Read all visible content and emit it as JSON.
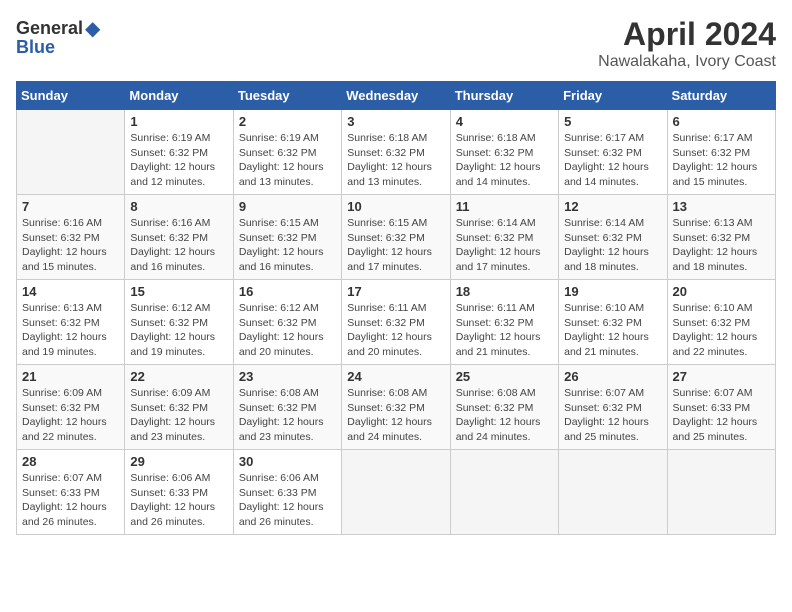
{
  "header": {
    "logo_general": "General",
    "logo_blue": "Blue",
    "month": "April 2024",
    "location": "Nawalakaha, Ivory Coast"
  },
  "weekdays": [
    "Sunday",
    "Monday",
    "Tuesday",
    "Wednesday",
    "Thursday",
    "Friday",
    "Saturday"
  ],
  "weeks": [
    [
      {
        "day": "",
        "info": ""
      },
      {
        "day": "1",
        "info": "Sunrise: 6:19 AM\nSunset: 6:32 PM\nDaylight: 12 hours\nand 12 minutes."
      },
      {
        "day": "2",
        "info": "Sunrise: 6:19 AM\nSunset: 6:32 PM\nDaylight: 12 hours\nand 13 minutes."
      },
      {
        "day": "3",
        "info": "Sunrise: 6:18 AM\nSunset: 6:32 PM\nDaylight: 12 hours\nand 13 minutes."
      },
      {
        "day": "4",
        "info": "Sunrise: 6:18 AM\nSunset: 6:32 PM\nDaylight: 12 hours\nand 14 minutes."
      },
      {
        "day": "5",
        "info": "Sunrise: 6:17 AM\nSunset: 6:32 PM\nDaylight: 12 hours\nand 14 minutes."
      },
      {
        "day": "6",
        "info": "Sunrise: 6:17 AM\nSunset: 6:32 PM\nDaylight: 12 hours\nand 15 minutes."
      }
    ],
    [
      {
        "day": "7",
        "info": "Sunrise: 6:16 AM\nSunset: 6:32 PM\nDaylight: 12 hours\nand 15 minutes."
      },
      {
        "day": "8",
        "info": "Sunrise: 6:16 AM\nSunset: 6:32 PM\nDaylight: 12 hours\nand 16 minutes."
      },
      {
        "day": "9",
        "info": "Sunrise: 6:15 AM\nSunset: 6:32 PM\nDaylight: 12 hours\nand 16 minutes."
      },
      {
        "day": "10",
        "info": "Sunrise: 6:15 AM\nSunset: 6:32 PM\nDaylight: 12 hours\nand 17 minutes."
      },
      {
        "day": "11",
        "info": "Sunrise: 6:14 AM\nSunset: 6:32 PM\nDaylight: 12 hours\nand 17 minutes."
      },
      {
        "day": "12",
        "info": "Sunrise: 6:14 AM\nSunset: 6:32 PM\nDaylight: 12 hours\nand 18 minutes."
      },
      {
        "day": "13",
        "info": "Sunrise: 6:13 AM\nSunset: 6:32 PM\nDaylight: 12 hours\nand 18 minutes."
      }
    ],
    [
      {
        "day": "14",
        "info": "Sunrise: 6:13 AM\nSunset: 6:32 PM\nDaylight: 12 hours\nand 19 minutes."
      },
      {
        "day": "15",
        "info": "Sunrise: 6:12 AM\nSunset: 6:32 PM\nDaylight: 12 hours\nand 19 minutes."
      },
      {
        "day": "16",
        "info": "Sunrise: 6:12 AM\nSunset: 6:32 PM\nDaylight: 12 hours\nand 20 minutes."
      },
      {
        "day": "17",
        "info": "Sunrise: 6:11 AM\nSunset: 6:32 PM\nDaylight: 12 hours\nand 20 minutes."
      },
      {
        "day": "18",
        "info": "Sunrise: 6:11 AM\nSunset: 6:32 PM\nDaylight: 12 hours\nand 21 minutes."
      },
      {
        "day": "19",
        "info": "Sunrise: 6:10 AM\nSunset: 6:32 PM\nDaylight: 12 hours\nand 21 minutes."
      },
      {
        "day": "20",
        "info": "Sunrise: 6:10 AM\nSunset: 6:32 PM\nDaylight: 12 hours\nand 22 minutes."
      }
    ],
    [
      {
        "day": "21",
        "info": "Sunrise: 6:09 AM\nSunset: 6:32 PM\nDaylight: 12 hours\nand 22 minutes."
      },
      {
        "day": "22",
        "info": "Sunrise: 6:09 AM\nSunset: 6:32 PM\nDaylight: 12 hours\nand 23 minutes."
      },
      {
        "day": "23",
        "info": "Sunrise: 6:08 AM\nSunset: 6:32 PM\nDaylight: 12 hours\nand 23 minutes."
      },
      {
        "day": "24",
        "info": "Sunrise: 6:08 AM\nSunset: 6:32 PM\nDaylight: 12 hours\nand 24 minutes."
      },
      {
        "day": "25",
        "info": "Sunrise: 6:08 AM\nSunset: 6:32 PM\nDaylight: 12 hours\nand 24 minutes."
      },
      {
        "day": "26",
        "info": "Sunrise: 6:07 AM\nSunset: 6:32 PM\nDaylight: 12 hours\nand 25 minutes."
      },
      {
        "day": "27",
        "info": "Sunrise: 6:07 AM\nSunset: 6:33 PM\nDaylight: 12 hours\nand 25 minutes."
      }
    ],
    [
      {
        "day": "28",
        "info": "Sunrise: 6:07 AM\nSunset: 6:33 PM\nDaylight: 12 hours\nand 26 minutes."
      },
      {
        "day": "29",
        "info": "Sunrise: 6:06 AM\nSunset: 6:33 PM\nDaylight: 12 hours\nand 26 minutes."
      },
      {
        "day": "30",
        "info": "Sunrise: 6:06 AM\nSunset: 6:33 PM\nDaylight: 12 hours\nand 26 minutes."
      },
      {
        "day": "",
        "info": ""
      },
      {
        "day": "",
        "info": ""
      },
      {
        "day": "",
        "info": ""
      },
      {
        "day": "",
        "info": ""
      }
    ]
  ]
}
